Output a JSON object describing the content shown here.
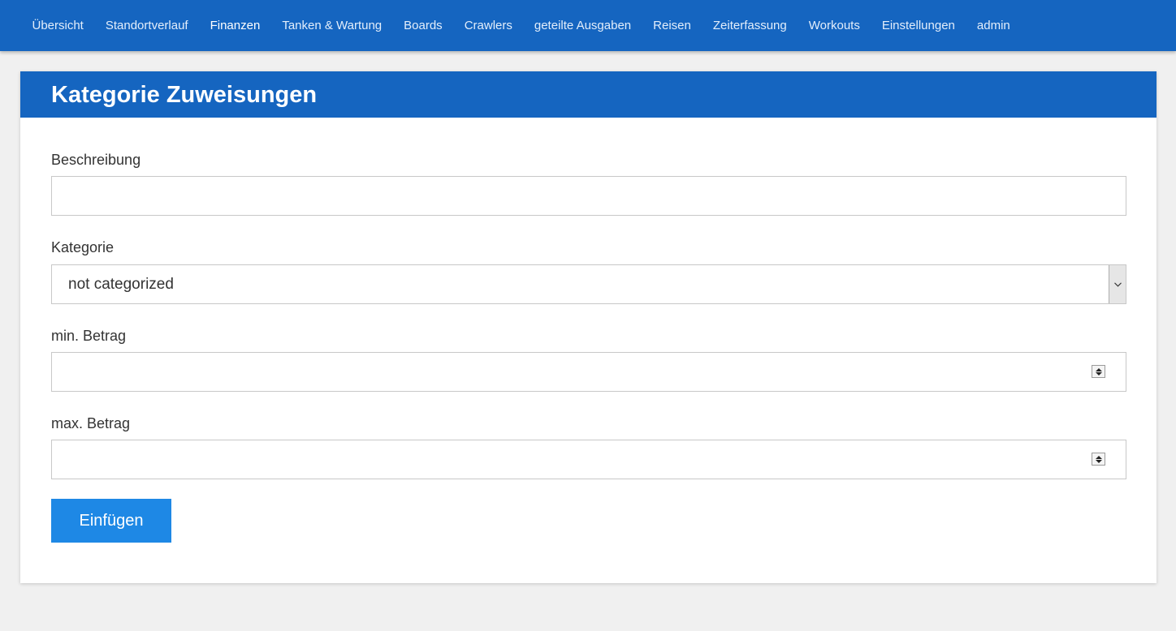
{
  "nav": {
    "items": [
      {
        "label": "Übersicht",
        "active": false
      },
      {
        "label": "Standortverlauf",
        "active": false
      },
      {
        "label": "Finanzen",
        "active": true
      },
      {
        "label": "Tanken & Wartung",
        "active": false
      },
      {
        "label": "Boards",
        "active": false
      },
      {
        "label": "Crawlers",
        "active": false
      },
      {
        "label": "geteilte Ausgaben",
        "active": false
      },
      {
        "label": "Reisen",
        "active": false
      },
      {
        "label": "Zeiterfassung",
        "active": false
      },
      {
        "label": "Workouts",
        "active": false
      },
      {
        "label": "Einstellungen",
        "active": false
      },
      {
        "label": "admin",
        "active": false
      }
    ]
  },
  "card": {
    "title": "Kategorie Zuweisungen"
  },
  "form": {
    "description_label": "Beschreibung",
    "description_value": "",
    "category_label": "Kategorie",
    "category_selected": "not categorized",
    "min_label": "min. Betrag",
    "min_value": "",
    "max_label": "max. Betrag",
    "max_value": "",
    "submit_label": "Einfügen"
  },
  "colors": {
    "primary": "#1565c0",
    "button": "#1e88e5",
    "background": "#f0f0f0"
  },
  "icons": {
    "select_arrow": "chevron-down-icon",
    "spinner": "spinner-arrows-icon"
  }
}
